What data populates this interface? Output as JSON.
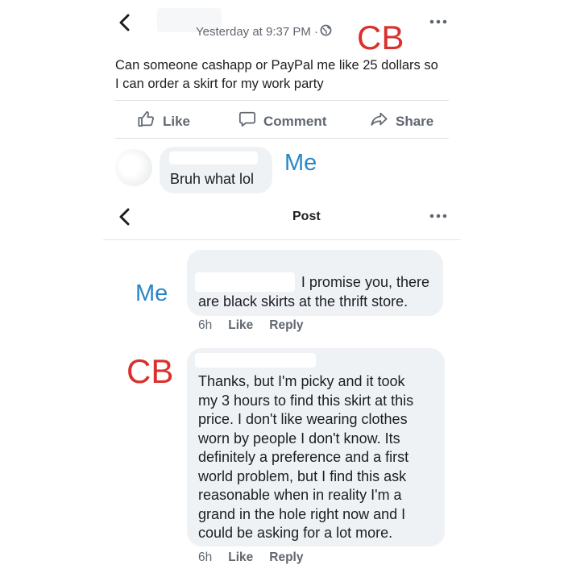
{
  "post": {
    "timestamp": "Yesterday at 9:37 PM · ",
    "privacy_icon": "globe-icon",
    "text_lines": [
      "Can someone cashapp or PayPal me like 25 dollars so",
      "I can order a skirt for my work party"
    ],
    "actions": {
      "like": "Like",
      "comment": "Comment",
      "share": "Share"
    }
  },
  "annotations": {
    "cb_top": "CB",
    "me_top": "Me",
    "me_mid": "Me",
    "cb_bottom": "CB"
  },
  "comment_top": {
    "text": "Bruh what lol"
  },
  "post_header": {
    "title": "Post"
  },
  "comment_me": {
    "lines": [
      "I promise you, there",
      "are black skirts at the thrift store."
    ],
    "time": "6h",
    "like": "Like",
    "reply": "Reply"
  },
  "comment_cb": {
    "lines": [
      "Thanks, but I'm picky and it took",
      "my 3 hours to find this skirt at this",
      "price. I don't like wearing clothes",
      "worn by people I don't know. Its",
      "definitely a preference and a first",
      "world problem, but I find this ask",
      "reasonable when in reality I'm a",
      "grand in the hole right now and I",
      "could be asking for a lot more."
    ],
    "time": "6h",
    "like": "Like",
    "reply": "Reply"
  },
  "colors": {
    "annotation_red": "#d9312d",
    "annotation_blue": "#2a86c8",
    "bubble": "#eff2f5"
  }
}
